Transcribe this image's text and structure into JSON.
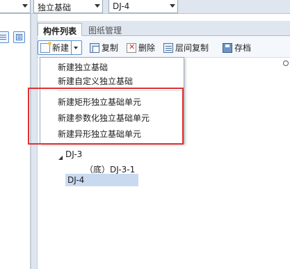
{
  "top_bar": {
    "combo_left": {
      "value": ""
    },
    "combo_type": {
      "value": "独立基础"
    },
    "combo_name": {
      "value": "DJ-4"
    }
  },
  "tabs": [
    {
      "label": "构件列表",
      "active": true
    },
    {
      "label": "图纸管理",
      "active": false
    }
  ],
  "toolbar": {
    "new_label": "新建",
    "copy_label": "复制",
    "delete_label": "删除",
    "floor_copy_label": "层间复制",
    "save_label": "存档"
  },
  "new_menu": {
    "items": [
      {
        "label": "新建独立基础"
      },
      {
        "label": "新建自定义独立基础"
      },
      {
        "label": "新建矩形独立基础单元"
      },
      {
        "label": "新建参数化独立基础单元"
      },
      {
        "label": "新建异形独立基础单元"
      }
    ]
  },
  "tree": {
    "expander": "◢",
    "items": [
      {
        "label": "DJ-3",
        "level": 0
      },
      {
        "label": "（底）DJ-3-1",
        "level": 1
      },
      {
        "label": "DJ-4",
        "level": 0,
        "selected": true
      }
    ]
  },
  "colors": {
    "highlight_box": "#e03030",
    "selection": "#c9daf0",
    "accent": "#5e8ecb"
  }
}
